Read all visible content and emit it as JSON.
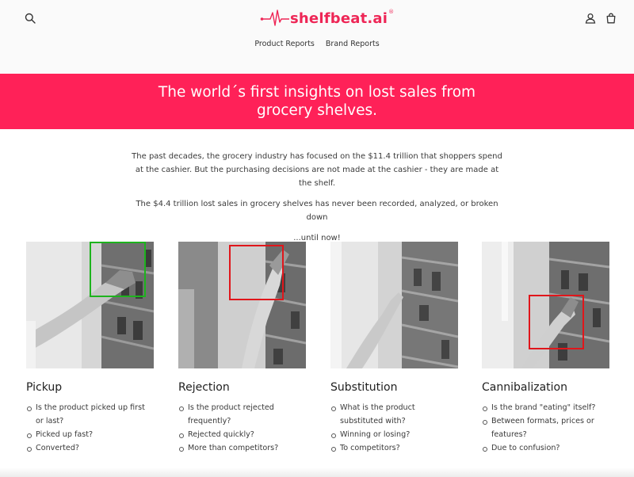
{
  "header": {
    "logo_text": "shelfbeat.ai",
    "logo_reg": "®",
    "brand_color": "#ee2656",
    "icons": {
      "search": "search-icon",
      "account": "account-icon",
      "cart": "cart-icon"
    }
  },
  "nav": {
    "items": [
      "Product Reports",
      "Brand Reports"
    ]
  },
  "hero": {
    "title": "The world´s first insights on lost sales from grocery shelves.",
    "background": "#ff2158"
  },
  "intro": {
    "p1": "The past decades, the grocery industry has focused on the $11.4 trillion that shoppers spend at the cashier. But the purchasing decisions are not made at the cashier - they are made at the shelf.",
    "p2": "The $4.4 trillion lost sales in grocery shelves has never been recorded, analyzed, or broken down",
    "p3": "...until now!"
  },
  "cards": [
    {
      "title": "Pickup",
      "box_color": "#1db31d",
      "bullets": [
        "Is the product picked up first or last?",
        "Picked up fast?",
        "Converted?"
      ]
    },
    {
      "title": "Rejection",
      "box_color": "#e0161b",
      "bullets": [
        "Is the product rejected frequently?",
        "Rejected quickly?",
        "More than competitors?"
      ]
    },
    {
      "title": "Substitution",
      "box_color": "",
      "bullets": [
        "What is the product substituted with?",
        "Winning or losing?",
        "To competitors?"
      ]
    },
    {
      "title": "Cannibalization",
      "box_color": "#e0161b",
      "bullets": [
        "Is the brand \"eating\" itself?",
        "Between formats, prices or features?",
        "Due to confusion?"
      ]
    }
  ]
}
